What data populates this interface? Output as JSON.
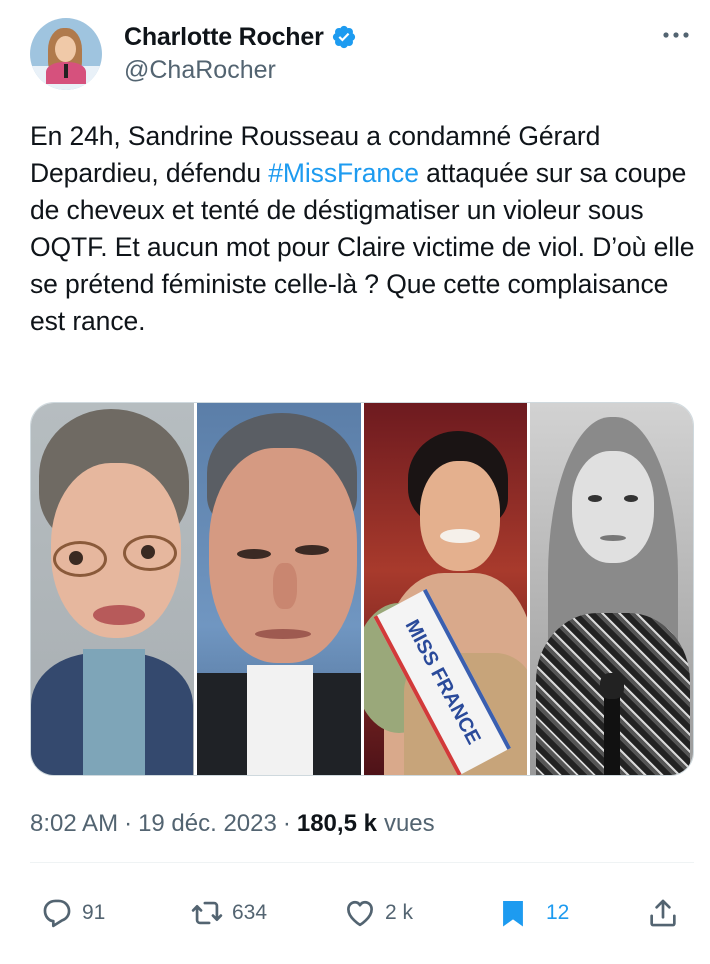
{
  "author": {
    "display_name": "Charlotte Rocher",
    "handle": "@ChaRocher",
    "verified": true,
    "avatar_icon": "profile-photo",
    "verified_color": "#1d9bf0"
  },
  "tweet": {
    "text_before": "En 24h, Sandrine Rousseau a condamné Gérard Depardieu, défendu ",
    "hashtag": "#MissFrance",
    "text_after": " attaquée sur sa coupe de cheveux et tenté de déstigmatiser un violeur sous OQTF. Et aucun mot pour Claire victime de viol. D’où elle se prétend féministe celle-là ? Que cette complaisance est rance.",
    "hashtag_color": "#1d9bf0"
  },
  "media": {
    "photos": [
      {
        "icon": "woman-grimacing-photo"
      },
      {
        "icon": "man-portrait-photo"
      },
      {
        "icon": "miss-france-photo",
        "sash_text": "MISS FRANCE"
      },
      {
        "icon": "woman-speaking-bw-photo"
      }
    ]
  },
  "meta": {
    "time": "8:02 AM",
    "separator": "·",
    "date": "19 déc. 2023",
    "separator2": "·",
    "views_count": "180,5 k",
    "views_label": "vues"
  },
  "actions": {
    "reply_count": "91",
    "retweet_count": "634",
    "like_count": "2 k",
    "bookmark_count": "12",
    "accent_color": "#1d9bf0",
    "icons": [
      "reply-icon",
      "retweet-icon",
      "like-icon",
      "bookmark-icon",
      "share-icon"
    ]
  }
}
